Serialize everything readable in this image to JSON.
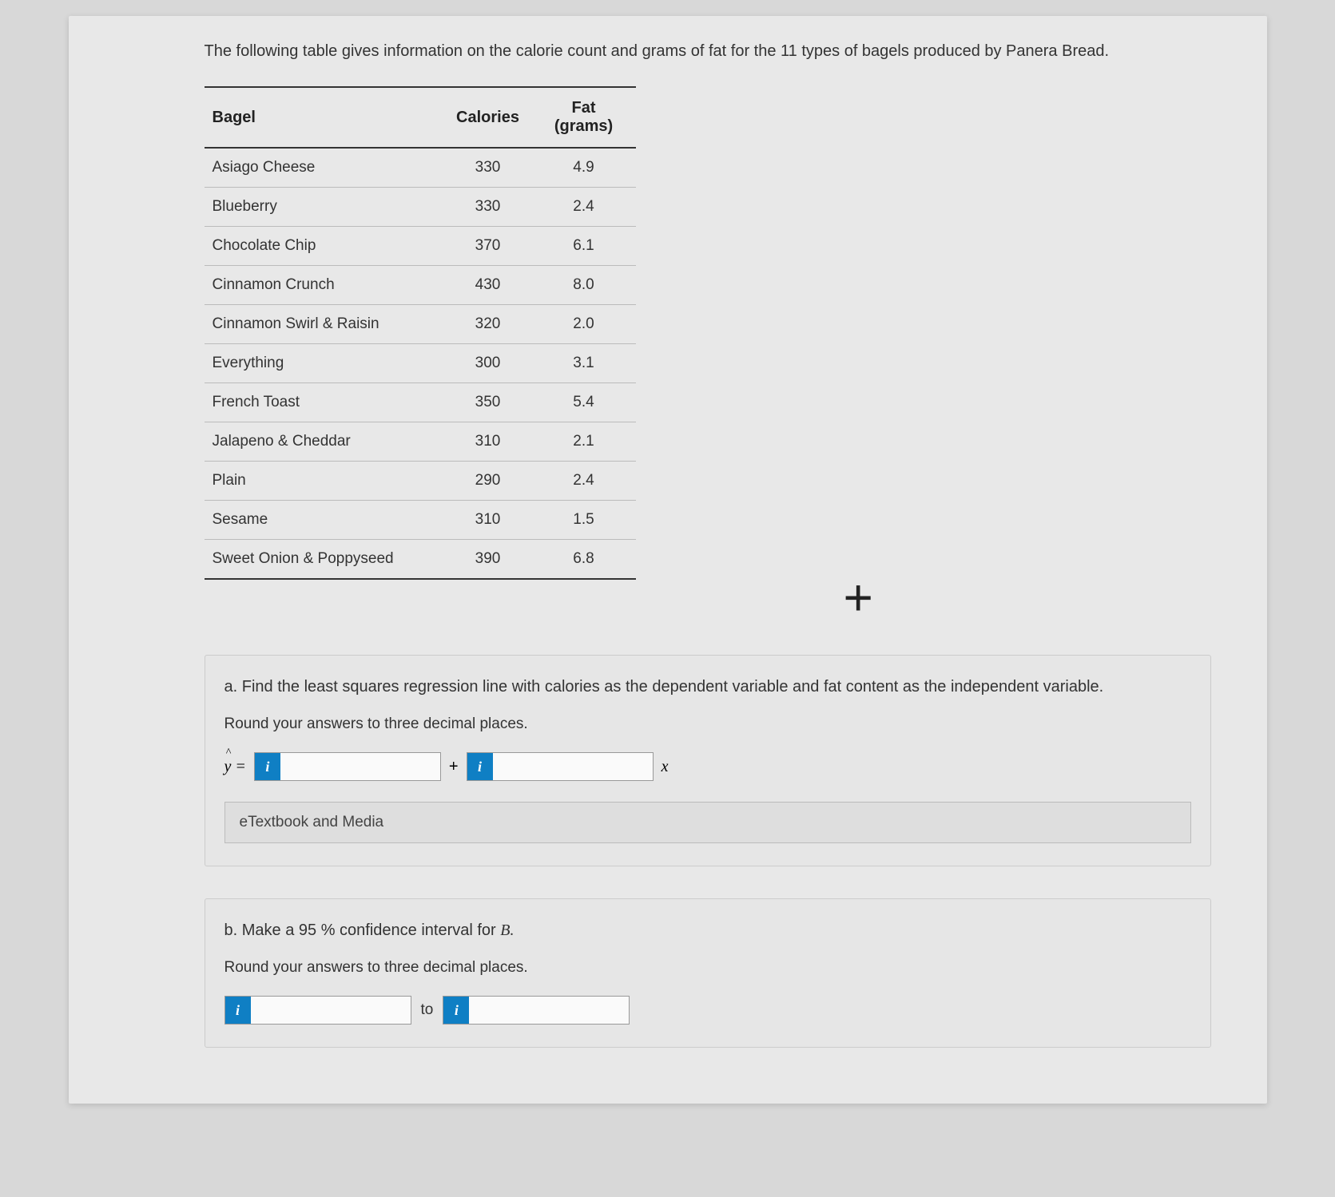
{
  "intro": "The following table gives information on the calorie count and grams of fat for the 11 types of bagels produced by Panera Bread.",
  "table": {
    "headers": [
      "Bagel",
      "Calories",
      "Fat (grams)"
    ],
    "rows": [
      {
        "name": "Asiago Cheese",
        "calories": "330",
        "fat": "4.9"
      },
      {
        "name": "Blueberry",
        "calories": "330",
        "fat": "2.4"
      },
      {
        "name": "Chocolate Chip",
        "calories": "370",
        "fat": "6.1"
      },
      {
        "name": "Cinnamon Crunch",
        "calories": "430",
        "fat": "8.0"
      },
      {
        "name": "Cinnamon Swirl & Raisin",
        "calories": "320",
        "fat": "2.0"
      },
      {
        "name": "Everything",
        "calories": "300",
        "fat": "3.1"
      },
      {
        "name": "French Toast",
        "calories": "350",
        "fat": "5.4"
      },
      {
        "name": "Jalapeno & Cheddar",
        "calories": "310",
        "fat": "2.1"
      },
      {
        "name": "Plain",
        "calories": "290",
        "fat": "2.4"
      },
      {
        "name": "Sesame",
        "calories": "310",
        "fat": "1.5"
      },
      {
        "name": "Sweet Onion & Poppyseed",
        "calories": "390",
        "fat": "6.8"
      }
    ]
  },
  "part_a": {
    "prompt_prefix": "a.",
    "prompt": "Find the least squares regression line with calories as the dependent variable and fat content as the independent variable.",
    "instruction": "Round your answers to three decimal places.",
    "yhat_label": "ŷ =",
    "plus": "+",
    "x_label": "x",
    "info_icon": "i"
  },
  "etextbook_label": "eTextbook and Media",
  "part_b": {
    "prompt_prefix": "b.",
    "prompt_text": "Make a 95 % confidence interval for",
    "b_var": "B.",
    "instruction": "Round your answers to three decimal places.",
    "to_label": "to",
    "info_icon": "i"
  }
}
